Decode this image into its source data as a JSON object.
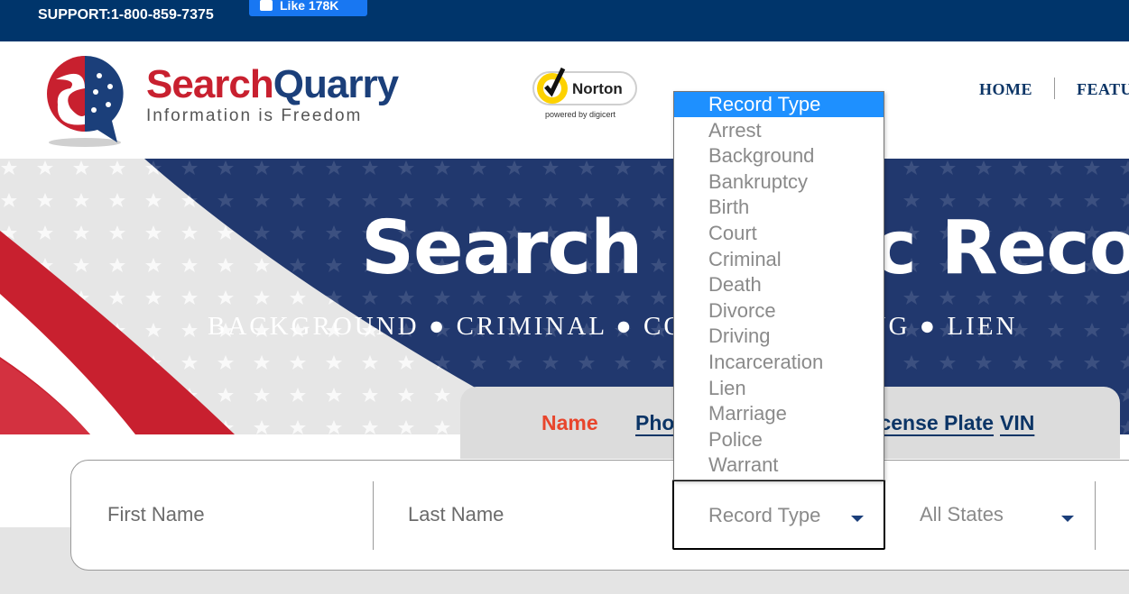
{
  "topbar": {
    "support": "SUPPORT:1-800-859-7375",
    "fb_like": "Like 178K"
  },
  "header": {
    "brand_part1": "Search",
    "brand_part2": "Quarry",
    "tagline": "Information is Freedom",
    "norton_label": "Norton",
    "norton_sub": "powered by digicert",
    "nav": [
      "HOME",
      "FEATU"
    ]
  },
  "hero": {
    "title": "Search Public Records",
    "subtitle": "BACKGROUND ● CRIMINAL ● COURT ● DRIVING ● LIEN"
  },
  "tabs": [
    "Name",
    "Phone",
    "License Plate",
    "VIN"
  ],
  "search": {
    "first_name_placeholder": "First Name",
    "last_name_placeholder": "Last Name",
    "record_type_value": "Record Type",
    "states_value": "All States"
  },
  "dropdown": {
    "options": [
      "Record Type",
      "Arrest",
      "Background",
      "Bankruptcy",
      "Birth",
      "Court",
      "Criminal",
      "Death",
      "Divorce",
      "Driving",
      "Incarceration",
      "Lien",
      "Marriage",
      "Police",
      "Warrant"
    ],
    "selected_index": 0
  },
  "colors": {
    "topbar": "#00356b",
    "hero_blue": "#21386e",
    "accent_red": "#e8452c",
    "dropdown_highlight": "#1e90ff",
    "brand_red": "#c8202f",
    "brand_blue": "#1b3f7a"
  }
}
